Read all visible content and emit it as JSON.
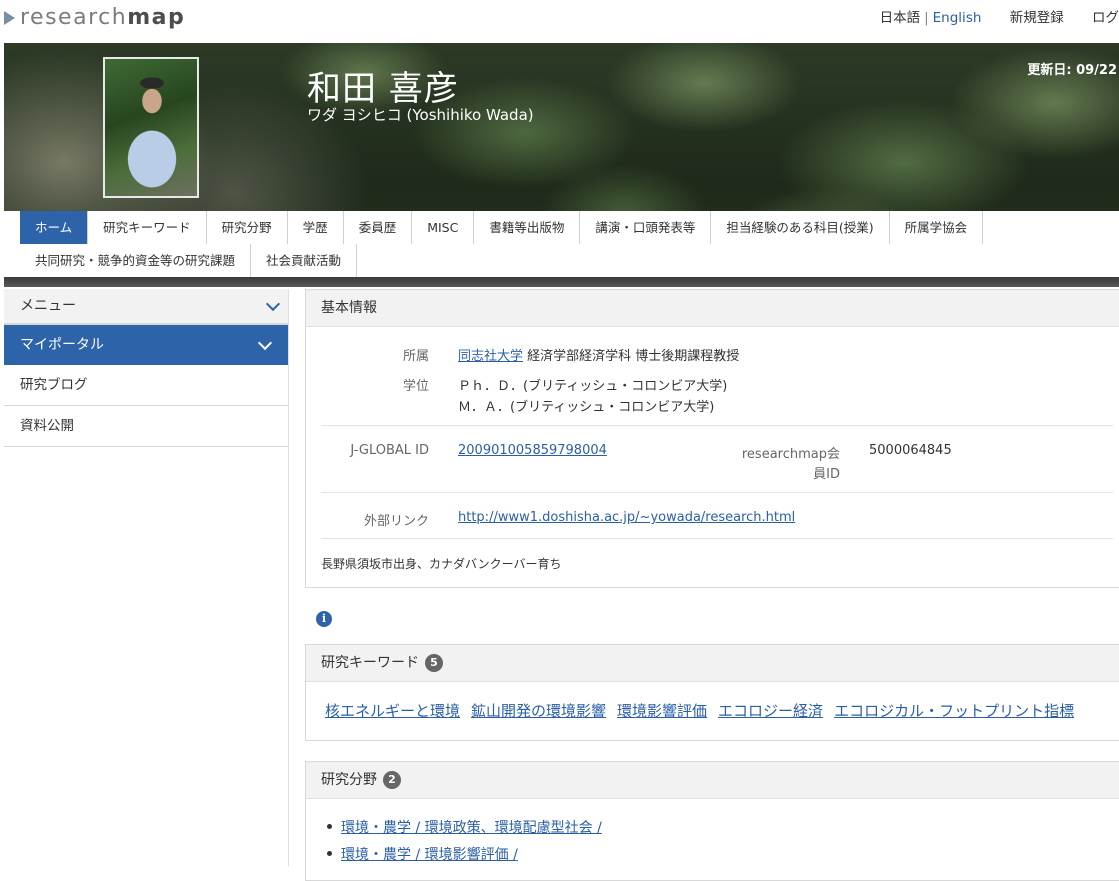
{
  "header": {
    "logo_light": "research",
    "logo_bold": "map",
    "lang_ja": "日本語",
    "lang_sep": "|",
    "lang_en": "English",
    "register": "新規登録",
    "login": "ログ"
  },
  "profile": {
    "name": "和田 喜彦",
    "kana": "ワダ ヨシヒコ  (Yoshihiko Wada)",
    "updated": "更新日: 09/22"
  },
  "nav": {
    "row1": [
      "ホーム",
      "研究キーワード",
      "研究分野",
      "学歴",
      "委員歴",
      "MISC",
      "書籍等出版物",
      "講演・口頭発表等",
      "担当経験のある科目(授業)",
      "所属学協会"
    ],
    "row2": [
      "共同研究・競争的資金等の研究課題",
      "社会貢献活動"
    ],
    "active": "ホーム"
  },
  "sidebar": {
    "menu": "メニュー",
    "portal": "マイポータル",
    "items": [
      "研究ブログ",
      "資料公開"
    ]
  },
  "basic": {
    "title": "基本情報",
    "affiliation_label": "所属",
    "affiliation_link": "同志社大学",
    "affiliation_rest": "経済学部経済学科 博士後期課程教授",
    "degree_label": "学位",
    "degrees": [
      "Ｐｈ．Ｄ．(ブリティッシュ・コロンビア大学)",
      "Ｍ．Ａ．(ブリティッシュ・コロンビア大学)"
    ],
    "jglobal_label": "J-GLOBAL ID",
    "jglobal_id": "200901005859798004",
    "rm_label_1": "researchmap会",
    "rm_label_2": "員ID",
    "rm_id": "5000064845",
    "ext_label": "外部リンク",
    "ext_url": "http://www1.doshisha.ac.jp/~yowada/research.html",
    "bio": "長野県須坂市出身、カナダバンクーバー育ち"
  },
  "keywords": {
    "title": "研究キーワード",
    "count": "5",
    "items": [
      "核エネルギーと環境",
      "鉱山開発の環境影響",
      "環境影響評価",
      "エコロジー経済",
      "エコロジカル・フットプリント指標"
    ]
  },
  "fields": {
    "title": "研究分野",
    "count": "2",
    "items": [
      "環境・農学 / 環境政策、環境配慮型社会 /",
      "環境・農学 / 環境影響評価 /"
    ]
  },
  "colors": {
    "accent": "#2d63a8",
    "link": "#2a5fa8"
  }
}
